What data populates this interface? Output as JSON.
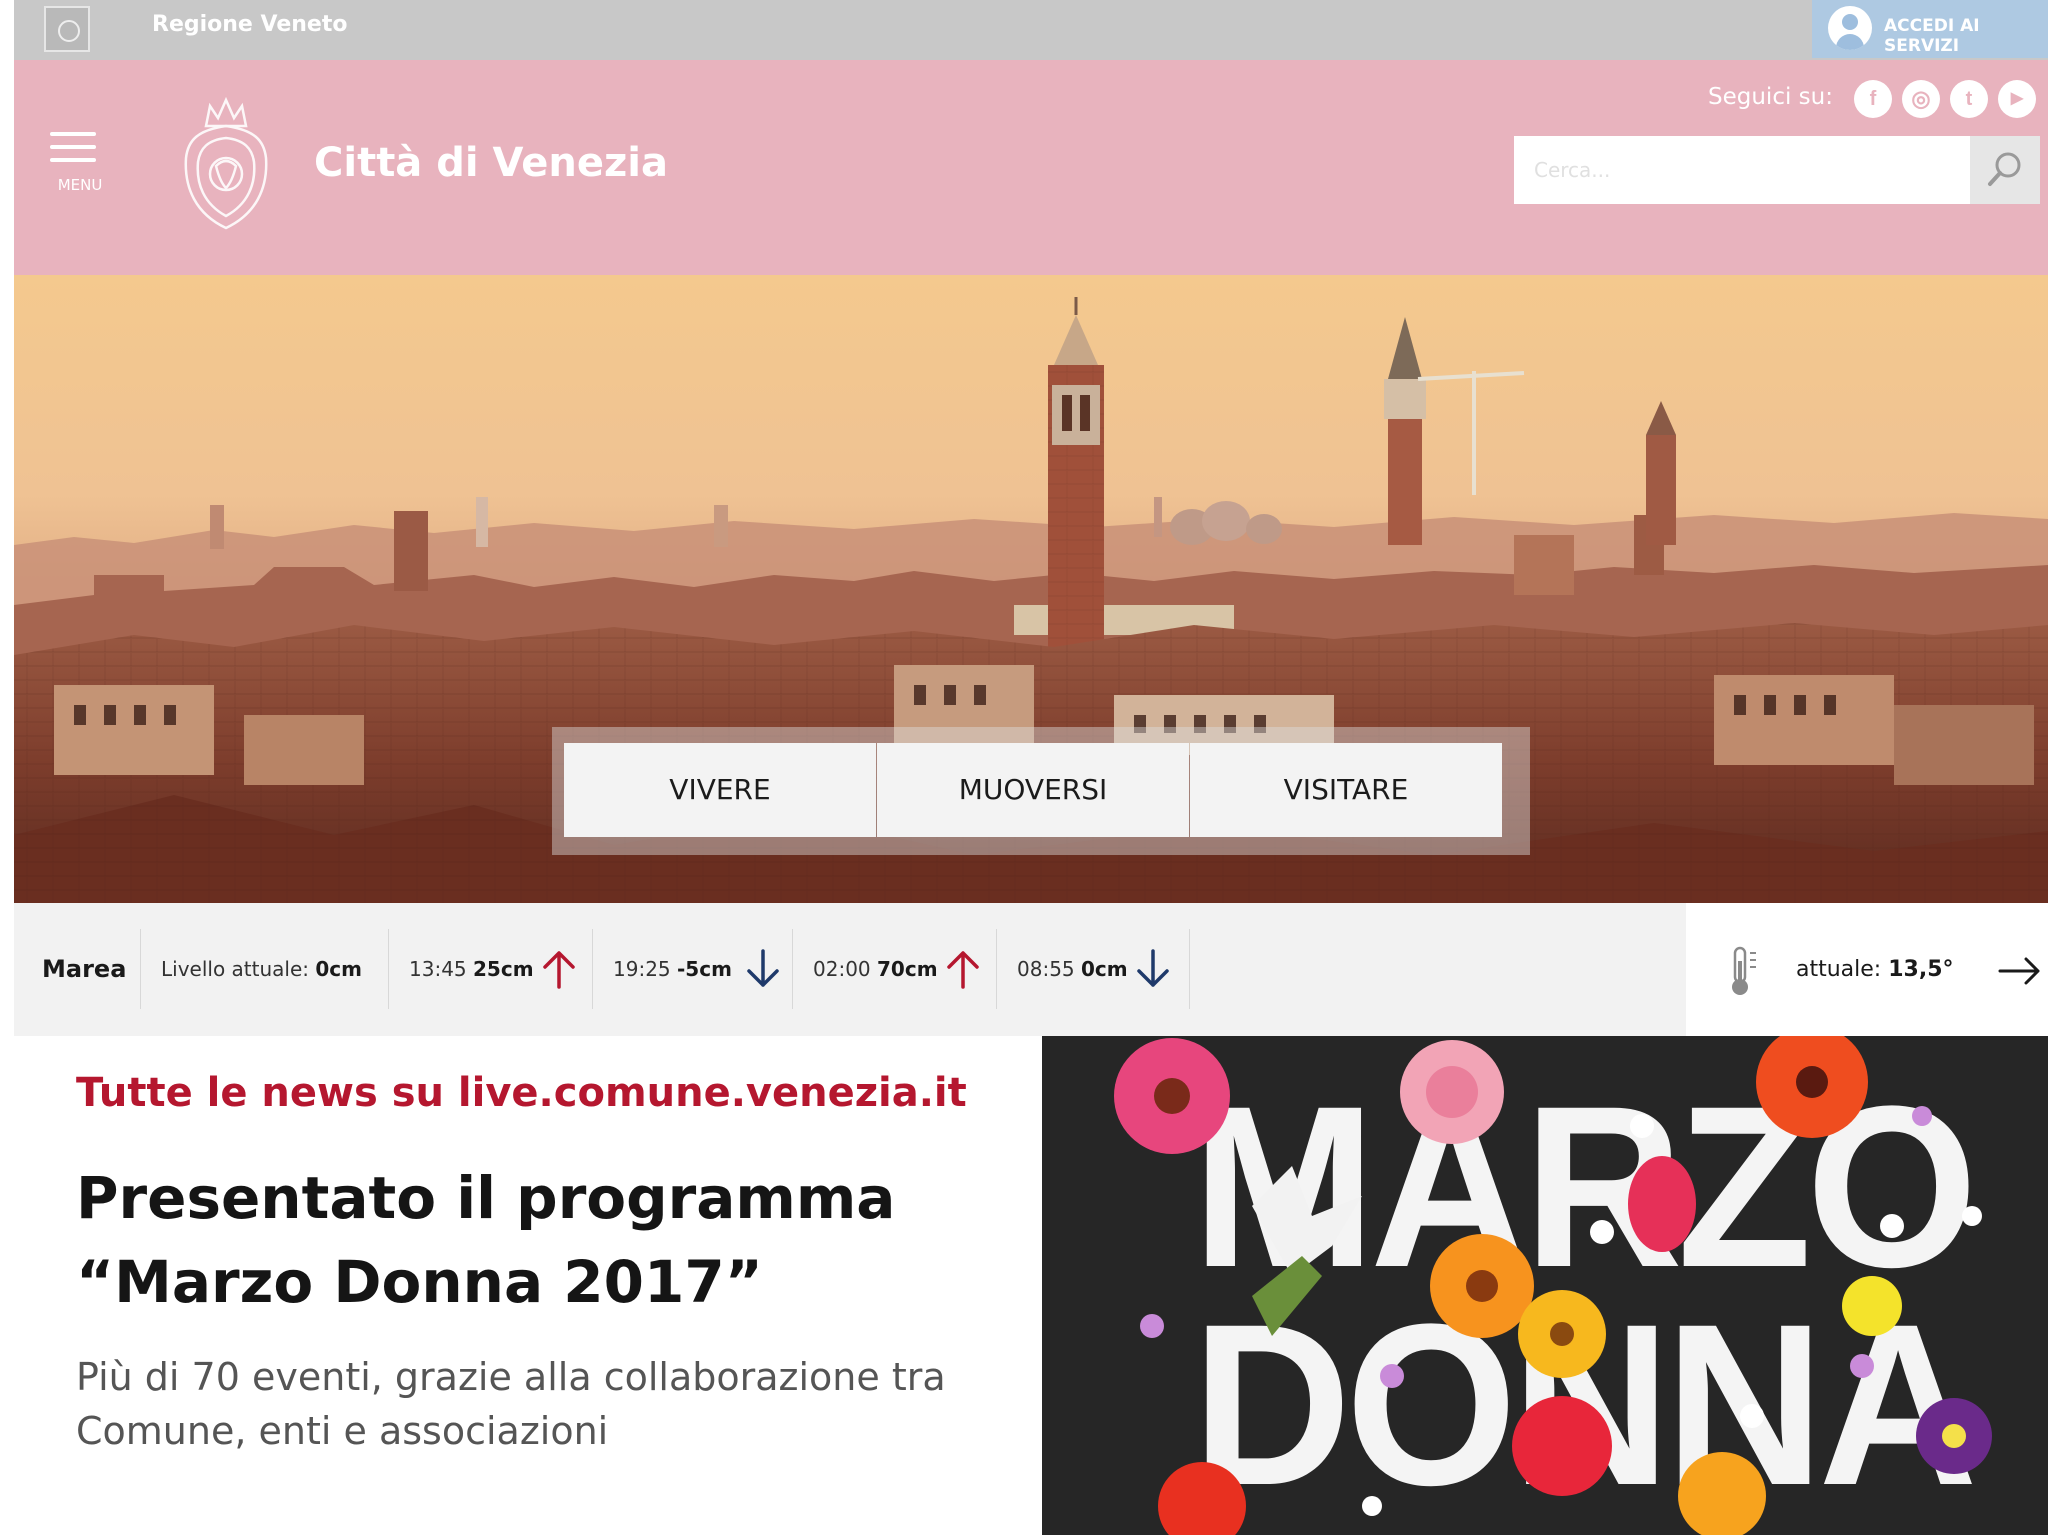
{
  "topbar": {
    "region_name": "Regione Veneto",
    "login_label": "ACCEDI AI SERVIZI"
  },
  "header": {
    "menu_label": "MENU",
    "city_name": "Città di Venezia",
    "follow_label": "Seguici su:",
    "social": [
      {
        "name": "facebook-icon",
        "glyph": "f"
      },
      {
        "name": "instagram-icon",
        "glyph": "◎"
      },
      {
        "name": "twitter-icon",
        "glyph": "t"
      },
      {
        "name": "youtube-icon",
        "glyph": "▶"
      }
    ],
    "search": {
      "placeholder": "Cerca...",
      "value": ""
    },
    "colors": {
      "topbar": "#c8c8c8",
      "header": "#e8b3be",
      "login": "#aec9e2"
    }
  },
  "hero": {
    "tabs": [
      "VIVERE",
      "MUOVERSI",
      "VISITARE"
    ]
  },
  "tide": {
    "title": "Marea",
    "current_label": "Livello attuale:",
    "current_value": "0cm",
    "forecasts": [
      {
        "time": "13:45",
        "value": "25cm",
        "direction": "up"
      },
      {
        "time": "19:25",
        "value": "-5cm",
        "direction": "down"
      },
      {
        "time": "02:00",
        "value": "70cm",
        "direction": "up"
      },
      {
        "time": "08:55",
        "value": "0cm",
        "direction": "down"
      }
    ],
    "colors": {
      "up": "#b5172f",
      "down": "#1f3a6b"
    }
  },
  "weather": {
    "label": "attuale:",
    "value": "13,5°"
  },
  "news": {
    "source": "Tutte le news su live.comune.venezia.it",
    "title_lines": [
      "Presentato il programma",
      "“Marzo Donna 2017”"
    ],
    "excerpt_lines": [
      "Più di 70 eventi, grazie alla collaborazione tra",
      "Comune, enti e associazioni"
    ],
    "image_words": [
      "MARZO",
      "DONNA"
    ],
    "accent": "#b5172f"
  }
}
